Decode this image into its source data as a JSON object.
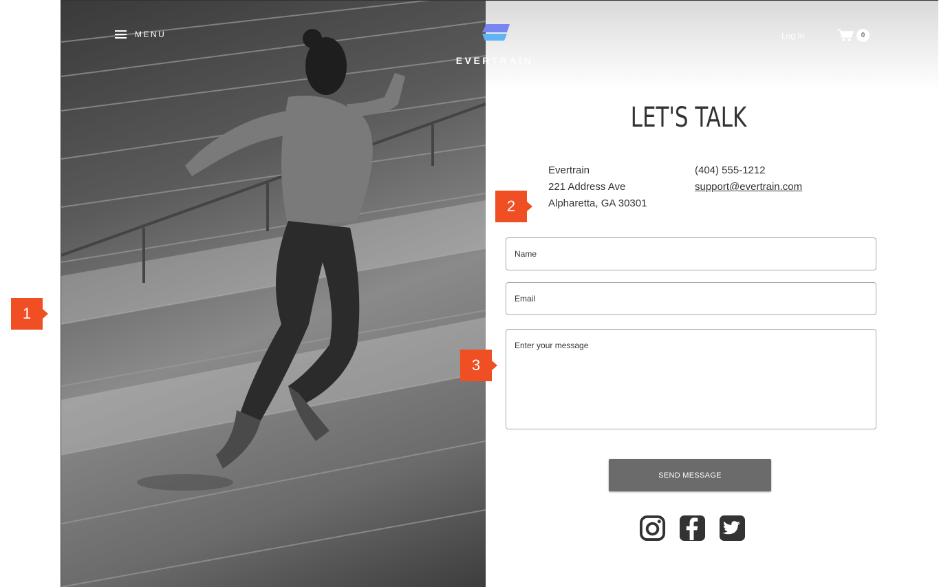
{
  "header": {
    "menu_label": "MENU",
    "brand": {
      "name_main": "EVER",
      "name_tail": "TRAIN"
    },
    "login_label": "Log In",
    "cart_count": "0"
  },
  "main": {
    "title": "LET'S TALK",
    "address": {
      "company": "Evertrain",
      "street": "221 Address Ave",
      "city": "Alpharetta, GA 30301"
    },
    "contact": {
      "phone": "(404) 555-1212",
      "email": "support@evertrain.com"
    },
    "form": {
      "name_placeholder": "Name",
      "email_placeholder": "Email",
      "message_placeholder": "Enter your message",
      "send_label": "SEND MESSAGE"
    },
    "socials": [
      "instagram-icon",
      "facebook-icon",
      "twitter-icon"
    ]
  },
  "annotations": [
    "1",
    "2",
    "3"
  ],
  "colors": {
    "accent": "#f04e23",
    "button": "#6b6b6b",
    "logo_top": "#7a86f0",
    "logo_bottom": "#5fb4f5"
  }
}
